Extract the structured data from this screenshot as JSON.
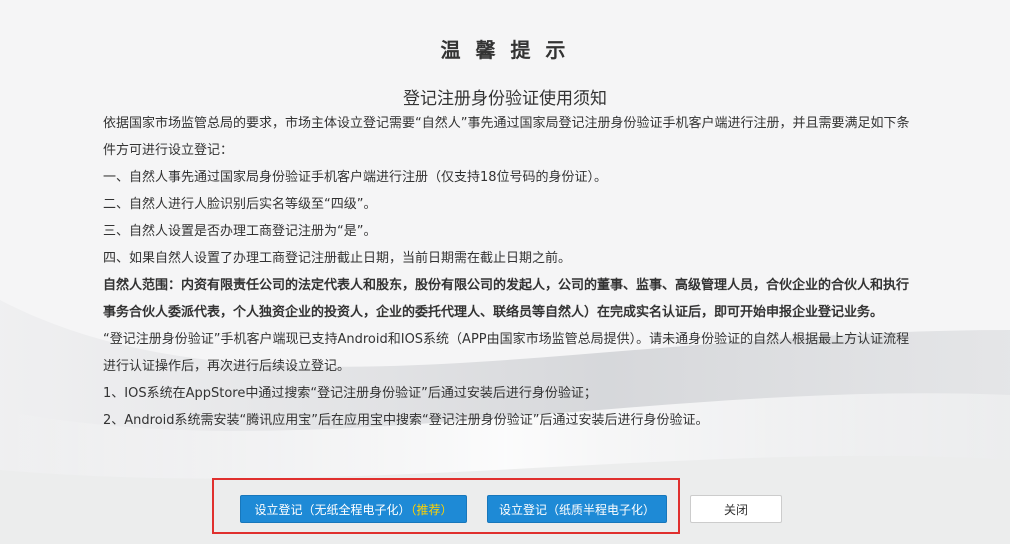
{
  "dialog": {
    "title": "温 馨 提 示",
    "subtitle": "登记注册身份验证使用须知",
    "paragraphs": [
      "依据国家市场监管总局的要求，市场主体设立登记需要“自然人”事先通过国家局登记注册身份验证手机客户端进行注册，并且需要满足如下条件方可进行设立登记：",
      "一、自然人事先通过国家局身份验证手机客户端进行注册（仅支持18位号码的身份证）。",
      "二、自然人进行人脸识别后实名等级至“四级”。",
      "三、自然人设置是否办理工商登记注册为“是”。",
      "四、如果自然人设置了办理工商登记注册截止日期，当前日期需在截止日期之前。"
    ],
    "bold_paragraph": "自然人范围：内资有限责任公司的法定代表人和股东，股份有限公司的发起人，公司的董事、监事、高级管理人员，合伙企业的合伙人和执行事务合伙人委派代表，个人独资企业的投资人，企业的委托代理人、联络员等自然人）在完成实名认证后，即可开始申报企业登记业务。",
    "paragraphs_after": [
      "“登记注册身份验证”手机客户端现已支持Android和IOS系统（APP由国家市场监管总局提供）。请未通身份验证的自然人根据最上方认证流程进行认证操作后，再次进行后续设立登记。",
      "1、IOS系统在AppStore中通过搜索“登记注册身份验证”后通过安装后进行身份验证；",
      "2、Android系统需安装“腾讯应用宝”后在应用宝中搜索“登记注册身份验证”后通过安装后进行身份验证。"
    ]
  },
  "buttons": {
    "paperless_label": "设立登记（无纸全程电子化）",
    "paperless_recommend": "（推荐）",
    "paper_label": "设立登记（纸质半程电子化）",
    "close_label": "关闭"
  },
  "colors": {
    "primary": "#1e8ad6",
    "highlight_frame": "#e0302e",
    "recommend_text": "#ffd200"
  }
}
